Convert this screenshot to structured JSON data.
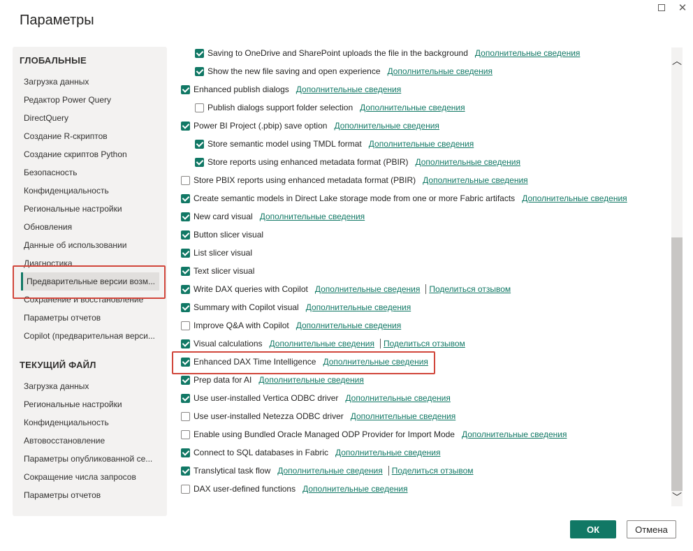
{
  "dialog": {
    "title": "Параметры",
    "ok_label": "ОК",
    "cancel_label": "Отмена"
  },
  "window_controls": {
    "maximize_icon": "maximize-icon",
    "close_icon": "close-icon",
    "close_glyph": "✕"
  },
  "sidebar": {
    "global_header": "ГЛОБАЛЬНЫЕ",
    "global_items": [
      "Загрузка данных",
      "Редактор Power Query",
      "DirectQuery",
      "Создание R-скриптов",
      "Создание скриптов Python",
      "Безопасность",
      "Конфиденциальность",
      "Региональные настройки",
      "Обновления",
      "Данные об использовании",
      "Диагностика",
      "Предварительные версии возм...",
      "Сохранение и восстановление",
      "Параметры отчетов",
      "Copilot (предварительная верси..."
    ],
    "selected_index": 11,
    "current_header": "ТЕКУЩИЙ ФАЙЛ",
    "current_items": [
      "Загрузка данных",
      "Региональные настройки",
      "Конфиденциальность",
      "Автовосстановление",
      "Параметры опубликованной се...",
      "Сокращение числа запросов",
      "Параметры отчетов"
    ]
  },
  "features": [
    {
      "label": "Saving to OneDrive and SharePoint uploads the file in the background",
      "checked": true,
      "indent": 1,
      "link": "Дополнительные сведения"
    },
    {
      "label": "Show the new file saving and open experience",
      "checked": true,
      "indent": 1,
      "link": "Дополнительные сведения"
    },
    {
      "label": "Enhanced publish dialogs",
      "checked": true,
      "indent": 0,
      "link": "Дополнительные сведения"
    },
    {
      "label": "Publish dialogs support folder selection",
      "checked": false,
      "indent": 1,
      "link": "Дополнительные сведения"
    },
    {
      "label": "Power BI Project (.pbip) save option",
      "checked": true,
      "indent": 0,
      "link": "Дополнительные сведения"
    },
    {
      "label": "Store semantic model using TMDL format",
      "checked": true,
      "indent": 1,
      "link": "Дополнительные сведения"
    },
    {
      "label": "Store reports using enhanced metadata format (PBIR)",
      "checked": true,
      "indent": 1,
      "link": "Дополнительные сведения"
    },
    {
      "label": "Store PBIX reports using enhanced metadata format (PBIR)",
      "checked": false,
      "indent": 0,
      "link": "Дополнительные сведения"
    },
    {
      "label": "Create semantic models in Direct Lake storage mode from one or more Fabric artifacts",
      "checked": true,
      "indent": 0,
      "link": "Дополнительные сведения"
    },
    {
      "label": "New card visual",
      "checked": true,
      "indent": 0,
      "link": "Дополнительные сведения"
    },
    {
      "label": "Button slicer visual",
      "checked": true,
      "indent": 0
    },
    {
      "label": "List slicer visual",
      "checked": true,
      "indent": 0
    },
    {
      "label": "Text slicer visual",
      "checked": true,
      "indent": 0
    },
    {
      "label": "Write DAX queries with Copilot",
      "checked": true,
      "indent": 0,
      "link": "Дополнительные сведения",
      "feedback": "Поделиться отзывом"
    },
    {
      "label": "Summary with Copilot visual",
      "checked": true,
      "indent": 0,
      "link": "Дополнительные сведения"
    },
    {
      "label": "Improve Q&A with Copilot",
      "checked": false,
      "indent": 0,
      "link": "Дополнительные сведения"
    },
    {
      "label": "Visual calculations",
      "checked": true,
      "indent": 0,
      "link": "Дополнительные сведения",
      "feedback": "Поделиться отзывом"
    },
    {
      "label": "Enhanced DAX Time Intelligence",
      "checked": true,
      "indent": 0,
      "link": "Дополнительные сведения"
    },
    {
      "label": "Prep data for AI",
      "checked": true,
      "indent": 0,
      "link": "Дополнительные сведения"
    },
    {
      "label": "Use user-installed Vertica ODBC driver",
      "checked": true,
      "indent": 0,
      "link": "Дополнительные сведения"
    },
    {
      "label": "Use user-installed Netezza ODBC driver",
      "checked": false,
      "indent": 0,
      "link": "Дополнительные сведения"
    },
    {
      "label": "Enable using Bundled Oracle Managed ODP Provider for Import Mode",
      "checked": false,
      "indent": 0,
      "link": "Дополнительные сведения"
    },
    {
      "label": "Connect to SQL databases in Fabric",
      "checked": true,
      "indent": 0,
      "link": "Дополнительные сведения"
    },
    {
      "label": "Translytical task flow",
      "checked": true,
      "indent": 0,
      "link": "Дополнительные сведения",
      "feedback": "Поделиться отзывом"
    },
    {
      "label": "DAX user-defined functions",
      "checked": false,
      "indent": 0,
      "link": "Дополнительные сведения"
    }
  ],
  "scrollbar": {
    "up_glyph": "︿",
    "down_glyph": "﹀",
    "position_fraction": 0.55
  },
  "colors": {
    "accent": "#117865",
    "highlight_box": "#d1463b"
  }
}
